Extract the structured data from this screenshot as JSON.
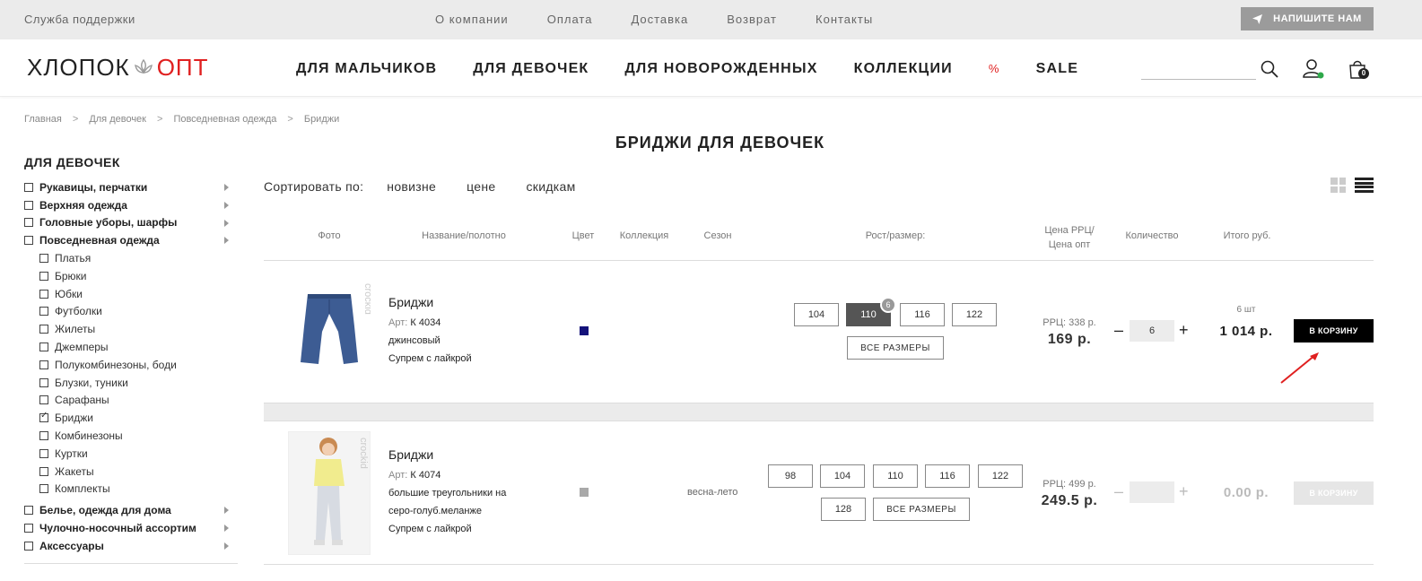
{
  "topbar": {
    "support": "Служба поддержки",
    "links": [
      "О компании",
      "Оплата",
      "Доставка",
      "Возврат",
      "Контакты"
    ],
    "write_btn": "НАПИШИТЕ НАМ"
  },
  "logo": {
    "part1": "ХЛОПОК",
    "part2": "ОПТ"
  },
  "nav": {
    "items": [
      "ДЛЯ МАЛЬЧИКОВ",
      "ДЛЯ ДЕВОЧЕК",
      "ДЛЯ НОВОРОЖДЕННЫХ",
      "КОЛЛЕКЦИИ"
    ],
    "sale_pct": "%",
    "sale": "SALE",
    "cart_count": "0"
  },
  "breadcrumb": [
    "Главная",
    "Для девочек",
    "Повседневная одежда",
    "Бриджи"
  ],
  "page_title": "БРИДЖИ ДЛЯ ДЕВОЧЕК",
  "sidebar": {
    "title": "ДЛЯ ДЕВОЧЕК",
    "items": [
      {
        "label": "Рукавицы, перчатки",
        "level": "top",
        "arrow": true,
        "checked": false
      },
      {
        "label": "Верхняя одежда",
        "level": "top",
        "arrow": true,
        "checked": false
      },
      {
        "label": "Головные уборы, шарфы",
        "level": "top",
        "arrow": true,
        "checked": false
      },
      {
        "label": "Повседневная одежда",
        "level": "top",
        "arrow": true,
        "checked": false
      },
      {
        "label": "Платья",
        "level": "sub",
        "checked": false
      },
      {
        "label": "Брюки",
        "level": "sub",
        "checked": false
      },
      {
        "label": "Юбки",
        "level": "sub",
        "checked": false
      },
      {
        "label": "Футболки",
        "level": "sub",
        "checked": false
      },
      {
        "label": "Жилеты",
        "level": "sub",
        "checked": false
      },
      {
        "label": "Джемперы",
        "level": "sub",
        "checked": false
      },
      {
        "label": "Полукомбинезоны, боди",
        "level": "sub",
        "checked": false
      },
      {
        "label": "Блузки, туники",
        "level": "sub",
        "checked": false
      },
      {
        "label": "Сарафаны",
        "level": "sub",
        "checked": false
      },
      {
        "label": "Бриджи",
        "level": "sub",
        "checked": true
      },
      {
        "label": "Комбинезоны",
        "level": "sub",
        "checked": false
      },
      {
        "label": "Куртки",
        "level": "sub",
        "checked": false
      },
      {
        "label": "Жакеты",
        "level": "sub",
        "checked": false
      },
      {
        "label": "Комплекты",
        "level": "sub",
        "checked": false
      },
      {
        "label": "Белье, одежда для дома",
        "level": "top",
        "arrow": true,
        "checked": false
      },
      {
        "label": "Чулочно-носочный ассортим",
        "level": "top",
        "arrow": true,
        "checked": false
      },
      {
        "label": "Аксессуары",
        "level": "top",
        "arrow": true,
        "checked": false
      }
    ]
  },
  "sort": {
    "label": "Сортировать по:",
    "options": [
      "новизне",
      "цене",
      "скидкам"
    ]
  },
  "table_headers": {
    "photo": "Фото",
    "name": "Название/полотно",
    "color": "Цвет",
    "collection": "Коллекция",
    "season": "Сезон",
    "size": "Рост/размер:",
    "price_1": "Цена РРЦ/",
    "price_2": "Цена опт",
    "qty": "Количество",
    "total": "Итого руб."
  },
  "products": [
    {
      "name": "Бриджи",
      "art_label": "Арт:",
      "art": "К 4034",
      "fabric1": "джинсовый",
      "fabric2": "Супрем с лайкрой",
      "color": "#14127a",
      "brand_watermark": "crockid",
      "season": "",
      "sizes_row1": [
        "104",
        "110",
        "116",
        "122"
      ],
      "sizes_row2": [],
      "active_size": "110",
      "active_badge": "6",
      "all_sizes": "ВСЕ РАЗМЕРЫ",
      "rrp": "РРЦ: 338 р.",
      "price": "169 р.",
      "qty": "6",
      "qty_count": "6 шт",
      "total": "1 014 р.",
      "cart": "В КОРЗИНУ",
      "enabled": true
    },
    {
      "name": "Бриджи",
      "art_label": "Арт:",
      "art": "К 4074",
      "fabric1": "большие треугольники на",
      "fabric2": "серо-голуб.меланже",
      "fabric3": "Супрем с лайкрой",
      "color": "#a9a9a9",
      "brand_watermark": "crockid",
      "season": "весна-лето",
      "sizes_row1": [
        "98",
        "104",
        "110",
        "116",
        "122"
      ],
      "sizes_row2": [
        "128"
      ],
      "all_sizes": "ВСЕ РАЗМЕРЫ",
      "rrp": "РРЦ: 499 р.",
      "price": "249.5 р.",
      "qty": "",
      "total": "0.00 р.",
      "cart": "В КОРЗИНУ",
      "enabled": false
    }
  ]
}
